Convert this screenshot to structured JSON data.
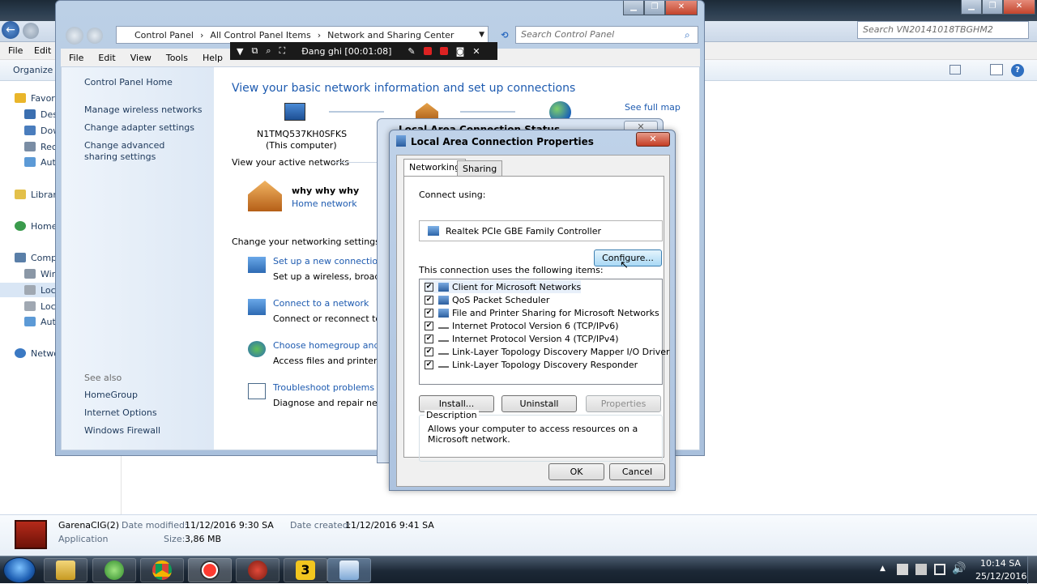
{
  "bg_explorer": {
    "search_placeholder": "Search VN20141018TBGHM2",
    "menu": [
      "File",
      "Edit"
    ],
    "organize_label": "Organize ▾",
    "nav": [
      "Favori",
      "Desk",
      "Dow",
      "Rece",
      "Auto",
      "Librari",
      "Home",
      "Comp",
      "Win",
      "Loca",
      "Loca",
      "Auto",
      "Netwo"
    ],
    "status": {
      "name": "GarenaCIG(2)",
      "type": "Application",
      "date_modified_label": "Date modified:",
      "date_modified": "11/12/2016 9:30 SA",
      "size_label": "Size:",
      "size": "3,86 MB",
      "date_created_label": "Date created:",
      "date_created": "11/12/2016 9:41 SA"
    }
  },
  "control_panel": {
    "breadcrumb": [
      "Control Panel",
      "All Control Panel Items",
      "Network and Sharing Center"
    ],
    "search_placeholder": "Search Control Panel",
    "menu": [
      "File",
      "Edit",
      "View",
      "Tools",
      "Help"
    ],
    "left_links": [
      "Control Panel Home",
      "Manage wireless networks",
      "Change adapter settings",
      "Change advanced sharing settings"
    ],
    "see_also_label": "See also",
    "see_also": [
      "HomeGroup",
      "Internet Options",
      "Windows Firewall"
    ],
    "heading": "View your basic network information and set up connections",
    "see_full_map": "See full map",
    "computer_name": "N1TMQ537KH0SFKS",
    "computer_sub": "(This computer)",
    "active_networks_label": "View your active networks",
    "network_name": "why why why",
    "network_type": "Home network",
    "change_settings_label": "Change your networking settings",
    "tasks": [
      {
        "title": "Set up a new connection o",
        "desc": "Set up a wireless, broadba"
      },
      {
        "title": "Connect to a network",
        "desc": "Connect or reconnect to a"
      },
      {
        "title": "Choose homegroup and s",
        "desc": "Access files and printers lo"
      },
      {
        "title": "Troubleshoot problems",
        "desc": "Diagnose and repair netwo"
      }
    ]
  },
  "recording_bar": {
    "label": "Đang ghi [00:01:08]"
  },
  "status_dialog": {
    "title": "Local Area Connection Status"
  },
  "properties": {
    "title": "Local Area Connection Properties",
    "close": "✕",
    "tabs": [
      "Networking",
      "Sharing"
    ],
    "connect_using_label": "Connect using:",
    "adapter": "Realtek PCIe GBE Family Controller",
    "configure_button": "Configure...",
    "items_label": "This connection uses the following items:",
    "items": [
      "Client for Microsoft Networks",
      "QoS Packet Scheduler",
      "File and Printer Sharing for Microsoft Networks",
      "Internet Protocol Version 6 (TCP/IPv6)",
      "Internet Protocol Version 4 (TCP/IPv4)",
      "Link-Layer Topology Discovery Mapper I/O Driver",
      "Link-Layer Topology Discovery Responder"
    ],
    "install_button": "Install...",
    "uninstall_button": "Uninstall",
    "properties_button": "Properties",
    "description_label": "Description",
    "description_text": "Allows your computer to access resources on a Microsoft network.",
    "ok_button": "OK",
    "cancel_button": "Cancel"
  },
  "taskbar": {
    "apps": [
      "start-orb",
      "file-explorer",
      "garena",
      "chrome",
      "recorder",
      "user-app",
      "game-3",
      "control-panel"
    ],
    "time": "10:14 SA",
    "date": "25/12/2016"
  },
  "colors": {
    "link": "#1e5bb0",
    "heading": "#1e5bb0",
    "taskbar": "#1c2836",
    "close_red": "#c43d24"
  }
}
